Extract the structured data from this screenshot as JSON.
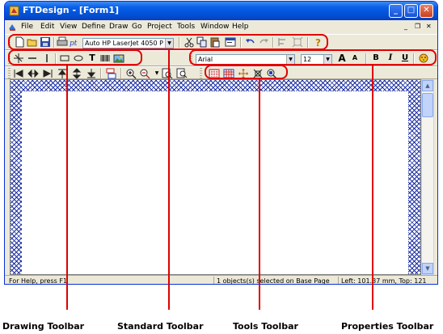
{
  "window": {
    "title": "FTDesign - [Form1]",
    "controls": {
      "minimize": "_",
      "maximize": "□",
      "close": "✕"
    },
    "mdi_controls": {
      "minimize": "_",
      "restore": "❐",
      "close": "✕"
    }
  },
  "menu": [
    "File",
    "Edit",
    "View",
    "Define",
    "Draw",
    "Go",
    "Project",
    "Tools",
    "Window",
    "Help"
  ],
  "standard_toolbar": {
    "printer_combo": "Auto HP LaserJet 4050 P",
    "icons": [
      "new-icon",
      "open-icon",
      "save-icon",
      "print-icon",
      "printer-select-icon",
      "cut-icon",
      "copy-icon",
      "paste-icon",
      "properties-icon",
      "undo-icon",
      "redo-icon",
      "align-icon",
      "resize-icon",
      "help-icon"
    ]
  },
  "drawing_toolbar": {
    "icons": [
      "select-arrow-icon",
      "line-icon",
      "vline-icon",
      "rectangle-icon",
      "ellipse-icon",
      "text-icon",
      "barcode-icon",
      "image-icon"
    ],
    "text_tool": "T"
  },
  "properties_toolbar": {
    "font": "Arial",
    "size": "12",
    "bold": "B",
    "italic": "I",
    "underline": "U",
    "grow_font": "A",
    "shrink_font": "A"
  },
  "tools_toolbar": {
    "icons": [
      "grid-icon",
      "grid-snap-icon",
      "move-icon",
      "fit-icon",
      "zoom-icon"
    ]
  },
  "nav_toolbar": {
    "icons": [
      "first-icon",
      "prev-icon",
      "next-icon",
      "top-icon",
      "middle-icon",
      "bottom-icon",
      "page-icon",
      "zoom-in-icon",
      "zoom-out-icon",
      "zoom-page-icon",
      "zoom-width-icon"
    ]
  },
  "status": {
    "help": "For Help, press F1",
    "selection": "1 objects(s) selected on Base Page",
    "position": "Left: 101.37 mm, Top: 121"
  },
  "callouts": {
    "drawing": "Drawing Toolbar",
    "standard": "Standard Toolbar",
    "tools": "Tools Toolbar",
    "properties": "Properties Toolbar"
  },
  "colors": {
    "highlight": "#e00000",
    "titlebar": "#0a5ee8",
    "pattern": "#1c2fa3"
  }
}
